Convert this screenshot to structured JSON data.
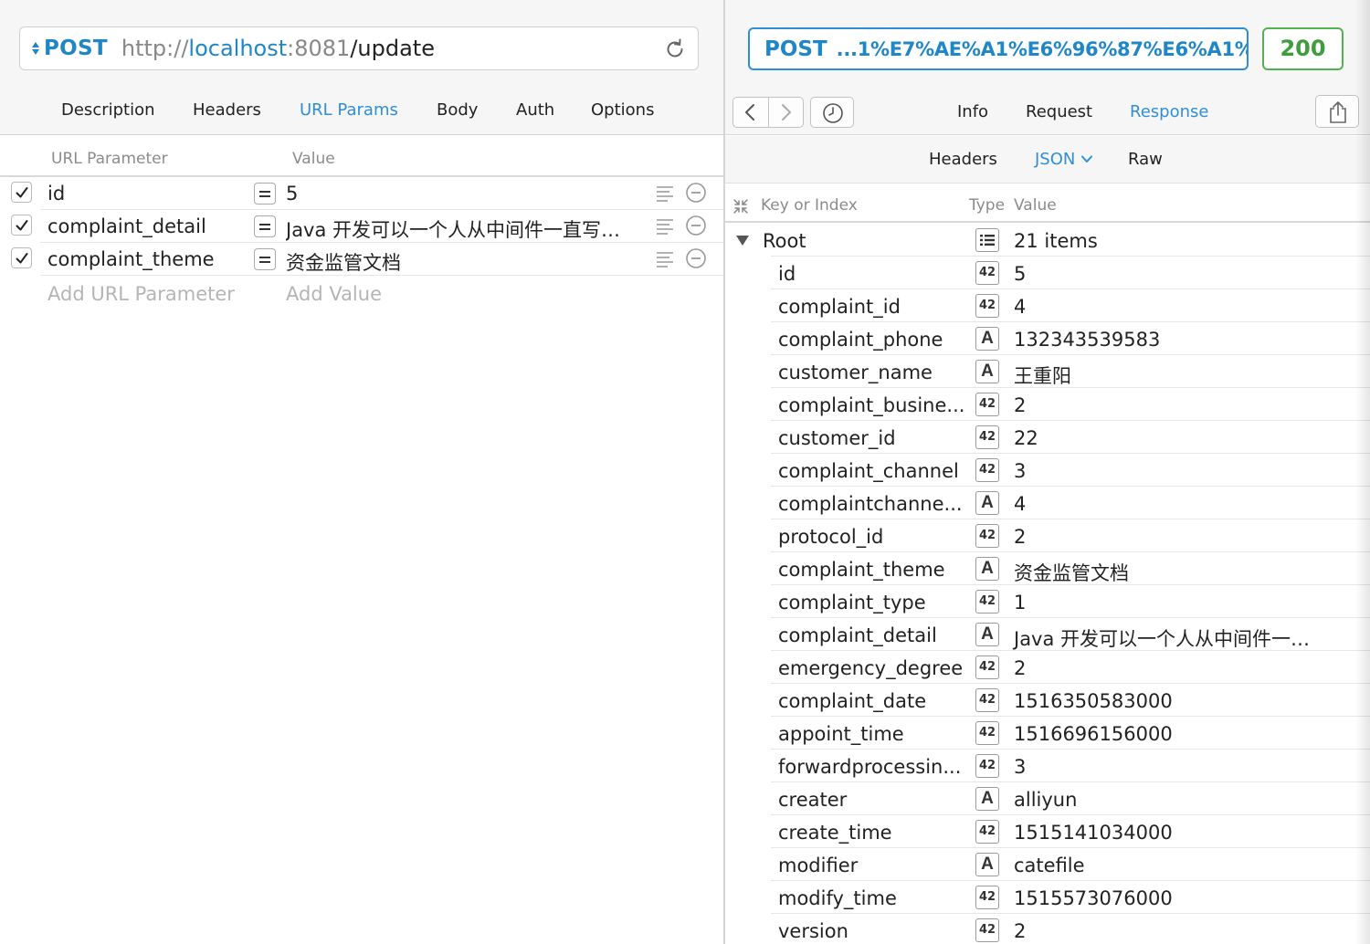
{
  "request": {
    "method": "POST",
    "url": {
      "scheme": "http://",
      "host": "localhost",
      "port": ":8081",
      "path": "/update"
    }
  },
  "left_tabs": [
    "Description",
    "Headers",
    "URL Params",
    "Body",
    "Auth",
    "Options"
  ],
  "left_active_tab": "URL Params",
  "params": {
    "header_key": "URL Parameter",
    "header_value": "Value",
    "rows": [
      {
        "key": "id",
        "value": "5",
        "enabled": true
      },
      {
        "key": "complaint_detail",
        "value": "Java 开发可以一个人从中间件一直写…",
        "enabled": true
      },
      {
        "key": "complaint_theme",
        "value": "资金监管文档",
        "enabled": true
      }
    ],
    "add_key_placeholder": "Add URL Parameter",
    "add_value_placeholder": "Add Value"
  },
  "response": {
    "summary_method": "POST",
    "summary_url": "...1%E7%AE%A1%E6%96%87%E6%A1%A3",
    "status": "200",
    "tabs": [
      "Info",
      "Request",
      "Response"
    ],
    "active_tab": "Response",
    "sub_tabs": [
      "Headers",
      "JSON",
      "Raw"
    ],
    "active_sub_tab": "JSON",
    "tree_header": {
      "key": "Key or Index",
      "type": "Type",
      "value": "Value"
    },
    "root": {
      "key": "Root",
      "value": "21 items"
    },
    "items": [
      {
        "key": "id",
        "type": "42",
        "value": "5"
      },
      {
        "key": "complaint_id",
        "type": "42",
        "value": "4"
      },
      {
        "key": "complaint_phone",
        "type": "A",
        "value": "132343539583"
      },
      {
        "key": "customer_name",
        "type": "A",
        "value": "王重阳"
      },
      {
        "key": "complaint_busine...",
        "type": "42",
        "value": "2"
      },
      {
        "key": "customer_id",
        "type": "42",
        "value": "22"
      },
      {
        "key": "complaint_channel",
        "type": "42",
        "value": "3"
      },
      {
        "key": "complaintchanne...",
        "type": "A",
        "value": "4"
      },
      {
        "key": "protocol_id",
        "type": "42",
        "value": "2"
      },
      {
        "key": "complaint_theme",
        "type": "A",
        "value": "资金监管文档"
      },
      {
        "key": "complaint_type",
        "type": "42",
        "value": "1"
      },
      {
        "key": "complaint_detail",
        "type": "A",
        "value": "Java 开发可以一个人从中间件一…"
      },
      {
        "key": "emergency_degree",
        "type": "42",
        "value": "2"
      },
      {
        "key": "complaint_date",
        "type": "42",
        "value": "1516350583000"
      },
      {
        "key": "appoint_time",
        "type": "42",
        "value": "1516696156000"
      },
      {
        "key": "forwardprocessin...",
        "type": "42",
        "value": "3"
      },
      {
        "key": "creater",
        "type": "A",
        "value": "alliyun"
      },
      {
        "key": "create_time",
        "type": "42",
        "value": "1515141034000"
      },
      {
        "key": "modifier",
        "type": "A",
        "value": "catefile"
      },
      {
        "key": "modify_time",
        "type": "42",
        "value": "1515573076000"
      },
      {
        "key": "version",
        "type": "42",
        "value": "2"
      }
    ]
  },
  "icons": {
    "reload": "reload-icon",
    "back": "chevron-left-icon",
    "forward": "chevron-right-icon",
    "history": "clock-icon",
    "share": "share-icon",
    "collapse": "collapse-arrows-icon",
    "array_badge": "list-icon"
  },
  "colors": {
    "accent": "#2f8fd6",
    "status_ok": "#4fb34f"
  }
}
